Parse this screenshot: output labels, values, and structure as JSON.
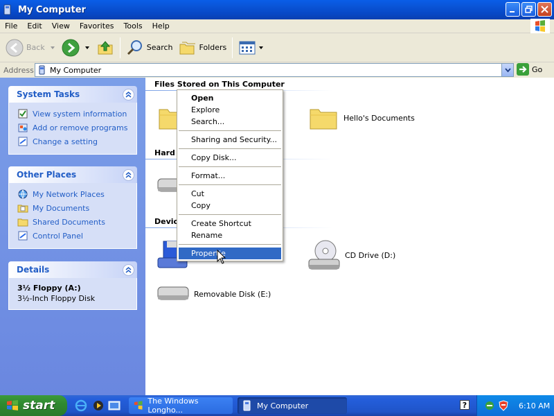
{
  "window": {
    "title": "My Computer"
  },
  "menubar": [
    "File",
    "Edit",
    "View",
    "Favorites",
    "Tools",
    "Help"
  ],
  "toolbar": {
    "back": "Back",
    "search": "Search",
    "folders": "Folders"
  },
  "address": {
    "label": "Address",
    "value": "My Computer",
    "go": "Go"
  },
  "tasks": {
    "system": {
      "title": "System Tasks",
      "items": [
        "View system information",
        "Add or remove programs",
        "Change a setting"
      ]
    },
    "other": {
      "title": "Other Places",
      "items": [
        "My Network Places",
        "My Documents",
        "Shared Documents",
        "Control Panel"
      ]
    },
    "details": {
      "title": "Details",
      "name": "3½ Floppy (A:)",
      "desc": "3½-Inch Floppy Disk"
    }
  },
  "groups": {
    "files": "Files Stored on This Computer",
    "hard": "Hard",
    "devices": "Devic"
  },
  "items": {
    "hello_docs": "Hello's Documents",
    "cd_drive": "CD Drive (D:)",
    "removable": "Removable Disk (E:)"
  },
  "context_menu": [
    "Open",
    "Explore",
    "Search...",
    "Sharing and Security...",
    "Copy Disk...",
    "Format...",
    "Cut",
    "Copy",
    "Create Shortcut",
    "Rename",
    "Propertie"
  ],
  "taskbar": {
    "start": "start",
    "tasks": [
      "The Windows Longho...",
      "My Computer"
    ],
    "time": "6:10 AM"
  },
  "colors": {
    "accent": "#316ac5",
    "panel_link": "#215dc6",
    "title_bar": "#0a55d8"
  }
}
